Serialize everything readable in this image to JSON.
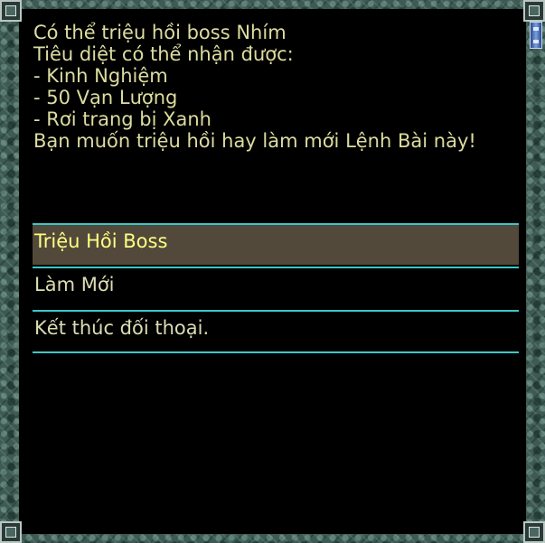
{
  "dialog": {
    "message_lines": [
      "Có thể triệu hồi boss Nhím",
      "Tiêu diệt có thể nhận được:",
      "- Kinh Nghiệm",
      "- 50 Vạn Lượng",
      "- Rơi trang bị Xanh",
      "Bạn muốn triệu hồi hay làm mới Lệnh Bài này!"
    ],
    "options": [
      {
        "label": "Triệu Hồi Boss",
        "selected": true
      },
      {
        "label": "Làm Mới",
        "selected": false
      },
      {
        "label": "Kết thúc đối thoại.",
        "selected": false
      }
    ]
  },
  "colors": {
    "text": "#dcdca0",
    "option_text": "#dcdcb4",
    "selected_text": "#ffff84",
    "selected_bg": "#52493a",
    "divider": "#3cc7c7",
    "border": "#3e5a52",
    "scroll_thumb": "#7aa0e0"
  },
  "icons": {
    "corner": "ornate-corner-icon",
    "scroll": "scroll-thumb-icon"
  }
}
